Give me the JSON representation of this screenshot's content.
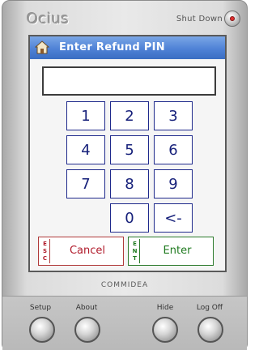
{
  "device": {
    "brand": "Ocius",
    "shutdown_label": "Shut Down",
    "model": "COMMIDEA"
  },
  "dialog": {
    "title": "Enter Refund PIN",
    "pin_value": ""
  },
  "keypad": {
    "k1": "1",
    "k2": "2",
    "k3": "3",
    "k4": "4",
    "k5": "5",
    "k6": "6",
    "k7": "7",
    "k8": "8",
    "k9": "9",
    "k0": "0",
    "back": "<-"
  },
  "actions": {
    "cancel_tag": [
      "E",
      "S",
      "C"
    ],
    "cancel_label": "Cancel",
    "enter_tag": [
      "E",
      "N",
      "T"
    ],
    "enter_label": "Enter"
  },
  "function_buttons": {
    "setup": "Setup",
    "about": "About",
    "hide": "Hide",
    "logoff": "Log Off"
  },
  "colors": {
    "titlebar": "#4f82d6",
    "key_text": "#16207a",
    "cancel": "#b01a2a",
    "enter": "#1f7a1f"
  }
}
